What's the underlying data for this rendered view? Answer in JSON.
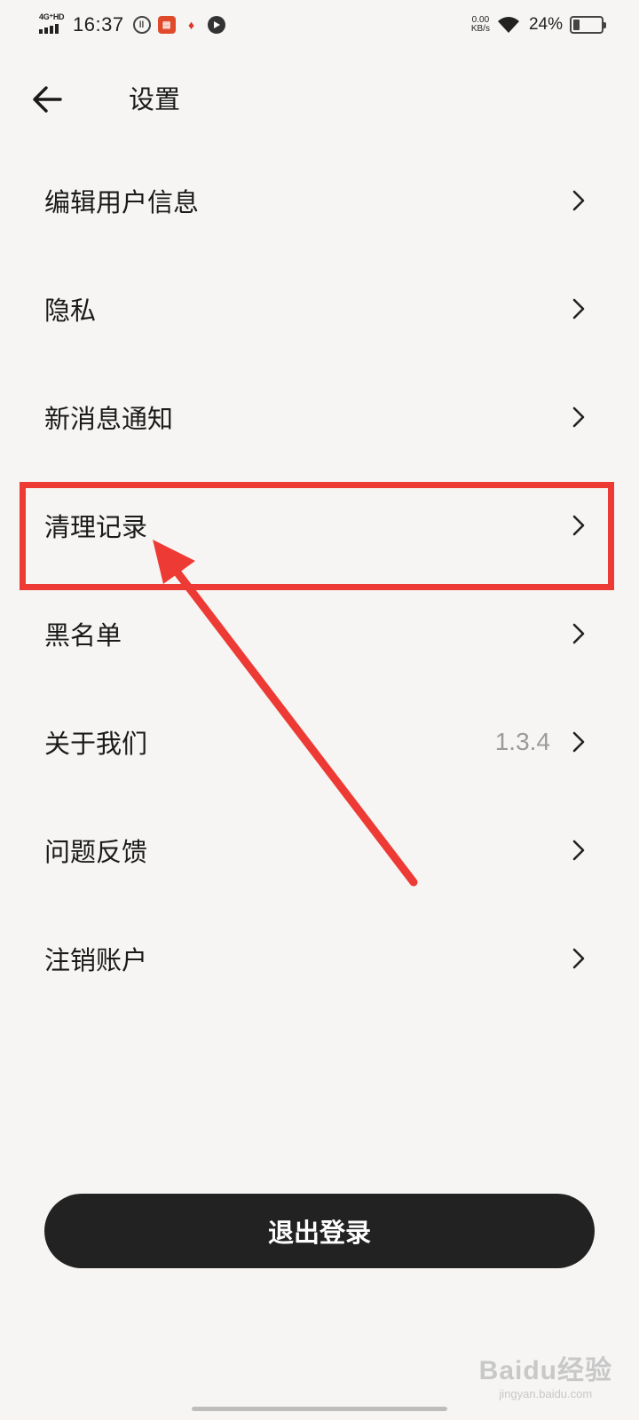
{
  "status_bar": {
    "network": "4G⁺HD",
    "time": "16:37",
    "speed_value": "0.00",
    "speed_unit": "KB/s",
    "battery_percent": "24%",
    "battery_level": 0.24
  },
  "header": {
    "back_icon": "arrow-left-icon",
    "title": "设置"
  },
  "menu": {
    "items": [
      {
        "label": "编辑用户信息",
        "value": ""
      },
      {
        "label": "隐私",
        "value": ""
      },
      {
        "label": "新消息通知",
        "value": ""
      },
      {
        "label": "清理记录",
        "value": ""
      },
      {
        "label": "黑名单",
        "value": ""
      },
      {
        "label": "关于我们",
        "value": "1.3.4"
      },
      {
        "label": "问题反馈",
        "value": ""
      },
      {
        "label": "注销账户",
        "value": ""
      }
    ]
  },
  "logout_button": {
    "label": "退出登录"
  },
  "annotation": {
    "highlighted_item": "清理记录",
    "color": "#ee3a35"
  },
  "watermark": {
    "brand": "Baidu经验",
    "url": "jingyan.baidu.com"
  },
  "colors": {
    "background": "#f6f5f3",
    "button": "#222222",
    "annotation": "#ee3a35"
  }
}
